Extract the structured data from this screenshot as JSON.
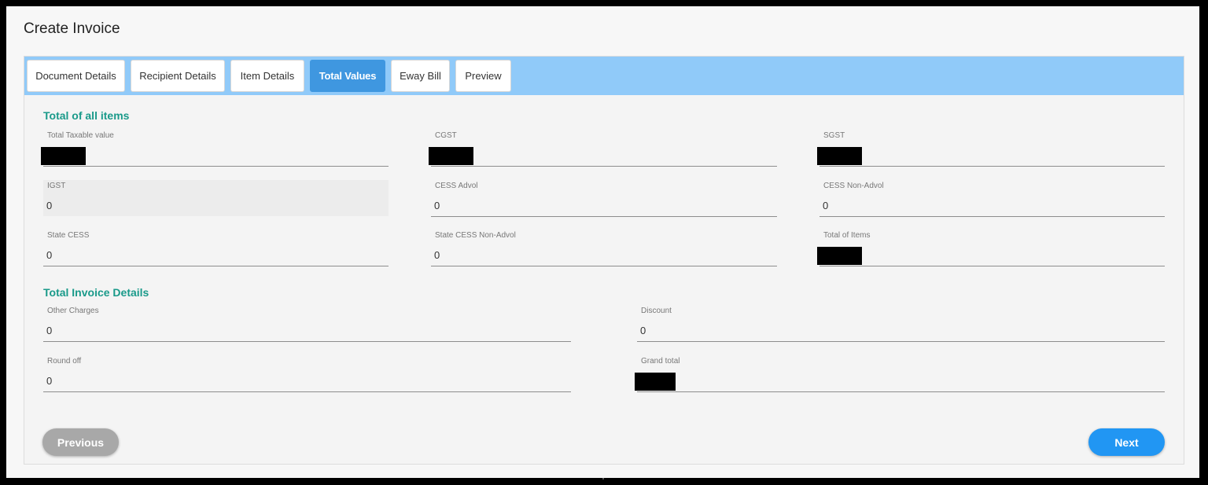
{
  "page": {
    "title": "Create Invoice"
  },
  "tabs": [
    {
      "label": "Document Details",
      "active": false
    },
    {
      "label": "Recipient Details",
      "active": false
    },
    {
      "label": "Item Details",
      "active": false
    },
    {
      "label": "Total Values",
      "active": true
    },
    {
      "label": "Eway Bill",
      "active": false
    },
    {
      "label": "Preview",
      "active": false
    }
  ],
  "totals": {
    "section_title": "Total of all items",
    "total_taxable_value": {
      "label": "Total Taxable value",
      "value": "",
      "redacted": true
    },
    "cgst": {
      "label": "CGST",
      "value": "",
      "redacted": true
    },
    "sgst": {
      "label": "SGST",
      "value": "",
      "redacted": true
    },
    "igst": {
      "label": "IGST",
      "value": "0",
      "disabled": true
    },
    "cess_advol": {
      "label": "CESS Advol",
      "value": "0"
    },
    "cess_non_advol": {
      "label": "CESS Non-Advol",
      "value": "0"
    },
    "state_cess": {
      "label": "State CESS",
      "value": "0"
    },
    "state_cess_non_advol": {
      "label": "State CESS Non-Advol",
      "value": "0"
    },
    "total_of_items": {
      "label": "Total of Items",
      "value": "",
      "redacted": true
    }
  },
  "invoice": {
    "section_title": "Total Invoice Details",
    "other_charges": {
      "label": "Other Charges",
      "value": "0"
    },
    "discount": {
      "label": "Discount",
      "value": "0"
    },
    "round_off": {
      "label": "Round off",
      "value": "0"
    },
    "grand_total": {
      "label": "Grand total",
      "value": "",
      "redacted": true
    }
  },
  "buttons": {
    "previous": "Previous",
    "next": "Next"
  },
  "colors": {
    "tabbar": "#90caf9",
    "active_tab": "#3f97e0",
    "section_title": "#1a9a8a",
    "next_button": "#2196f3",
    "previous_button": "#a8a8a8"
  }
}
